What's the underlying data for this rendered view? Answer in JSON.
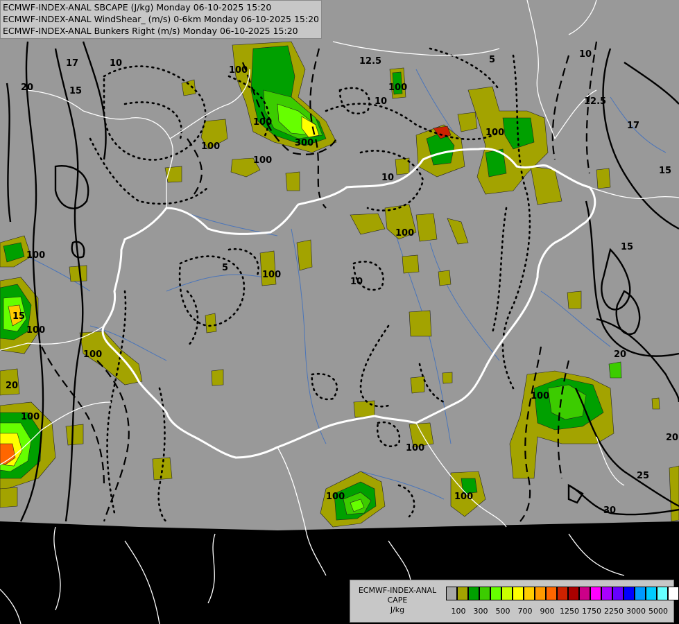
{
  "header": {
    "line1": "ECMWF-INDEX-ANAL SBCAPE (J/kg) Monday 06-10-2025 15:20",
    "line2": "ECMWF-INDEX-ANAL WindShear_ (m/s) 0-6km Monday 06-10-2025 15:20",
    "line3": "ECMWF-INDEX-ANAL Bunkers Right (m/s) Monday 06-10-2025 15:20"
  },
  "legend": {
    "title_line1": "ECMWF-INDEX-ANAL",
    "title_line2": "CAPE",
    "title_line3": "J/kg",
    "colors": [
      "#a8a8a8",
      "#a3a300",
      "#00a000",
      "#3ccc00",
      "#66ff00",
      "#c8ff00",
      "#ffff00",
      "#ffcc00",
      "#ff9900",
      "#ff6600",
      "#cc2200",
      "#aa0000",
      "#cc0088",
      "#ff00ff",
      "#aa00ff",
      "#6600ff",
      "#0000ff",
      "#0099ff",
      "#00ccff",
      "#66ffff",
      "#ffffff"
    ],
    "tick_labels": [
      "100",
      "300",
      "500",
      "700",
      "900",
      "1250",
      "1750",
      "2250",
      "3000",
      "5000"
    ]
  },
  "contour_labels": {
    "windshear": [
      "17",
      "20",
      "15",
      "10",
      "12.5",
      "5",
      "10",
      "17",
      "15",
      "15",
      "20",
      "20",
      "25",
      "30",
      "12.5",
      "10",
      "10",
      "5",
      "10",
      "15",
      "20"
    ],
    "cape": [
      "100",
      "100",
      "100",
      "300",
      "100",
      "100",
      "100",
      "100",
      "100",
      "100",
      "100",
      "100",
      "100",
      "100",
      "100",
      "100",
      "100"
    ]
  },
  "colors": {
    "domain_fill": "#999999",
    "outside": "#000000",
    "border": "#ffffff",
    "river": "#3d6fbf"
  }
}
